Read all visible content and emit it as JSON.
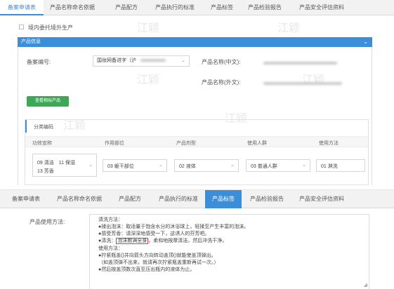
{
  "tabs": [
    "备案申请表",
    "产品名称命名依据",
    "产品配方",
    "产品执行的标准",
    "产品标签",
    "产品检验报告",
    "产品安全评估资料"
  ],
  "watermark": "江颖",
  "checkbox_label": "境内委托境外生产",
  "panel_title": "产品信息",
  "filing_no_label": "备案编号:",
  "filing_no_value": "国妆网备进字（沪",
  "product_name_cn_label": "产品名称(中文):",
  "product_name_en_label": "产品名称(外文):",
  "view_button": "查看相似产品",
  "category_title": "分类编码",
  "table_headers": [
    "功效宣称",
    "作用部位",
    "产品剂型",
    "使用人群",
    "使用方法"
  ],
  "table_row": {
    "efficacy_line1": "09 清洁　11 保湿",
    "efficacy_line2": "13 芳香",
    "part": "03 躯干部位",
    "form": "02 液体",
    "people": "03 普通人群",
    "method": "01 淋洗"
  },
  "usage_label": "产品使用方法:",
  "usage_lines": [
    "清洗方法：",
    "●揉出泡沫：取适量于饱含水分的沐浴球上，轻揉至产生丰富的泡沫。",
    "●感受芳香：请深深地感受一下，这诱人的芬芳吧。",
    "●清洗：",
    "泡沫敷满全身",
    "，柔和地按摩清洁，然后冲洗干净。",
    "使用方法：",
    "●拧紧瓶盖()并向箭头方向转动盖顶()就能使盖顶弹出。",
    "（如盖顶弹不出来，就请再次拧紧瓶盖重新再试一次。）",
    "●然后按盖顶数次直至压出瓶内的液体为止。"
  ]
}
